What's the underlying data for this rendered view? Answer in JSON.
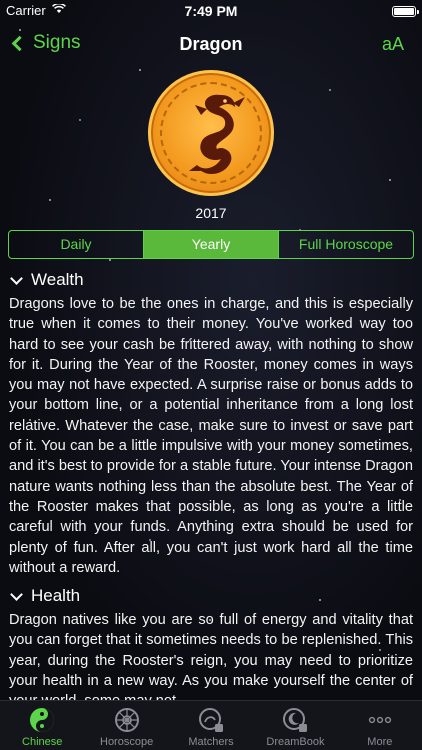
{
  "status_bar": {
    "carrier": "Carrier",
    "time": "7:49 PM"
  },
  "nav": {
    "back_label": "Signs",
    "title": "Dragon",
    "font_size_label": "aA"
  },
  "emblem": {
    "icon": "dragon-emblem-icon",
    "accent": "#f39a1f"
  },
  "year": "2017",
  "segments": {
    "items": [
      "Daily",
      "Yearly",
      "Full Horoscope"
    ],
    "selected": "Yearly",
    "accent": "#5dd54a"
  },
  "sections": [
    {
      "heading": "Wealth",
      "text": "Dragons love to be the ones in charge, and this is especially true when it comes to their money. You've worked way too hard to see your cash be frittered away, with nothing to show for it. During the Year of the Rooster, money comes in ways you may not have expected. A surprise raise or bonus adds to your bottom line, or a potential inheritance from a long lost relative. Whatever the case, make sure to invest or save part of it. You can be a little impulsive with your money sometimes, and it's best to provide for a stable future. Your intense Dragon nature wants nothing less than the absolute best. The Year of the Rooster makes that possible, as long as you're a little careful with your funds. Anything extra should be used for plenty of fun. After all, you can't just work hard all the time without a reward."
    },
    {
      "heading": "Health",
      "text": "Dragon natives like you are so full of energy and vitality that you can forget that it sometimes needs to be replenished. This year, during the Rooster's reign, you may need to prioritize your health in a new way. As you make yourself the center of your world, some may not"
    }
  ],
  "tab_bar": {
    "items": [
      {
        "label": "Chinese",
        "icon": "yin-yang-icon",
        "active": true
      },
      {
        "label": "Horoscope",
        "icon": "wheel-icon",
        "active": false
      },
      {
        "label": "Matchers",
        "icon": "matchers-icon",
        "active": false
      },
      {
        "label": "DreamBook",
        "icon": "dreambook-icon",
        "active": false
      },
      {
        "label": "More",
        "icon": "more-icon",
        "active": false
      }
    ]
  }
}
